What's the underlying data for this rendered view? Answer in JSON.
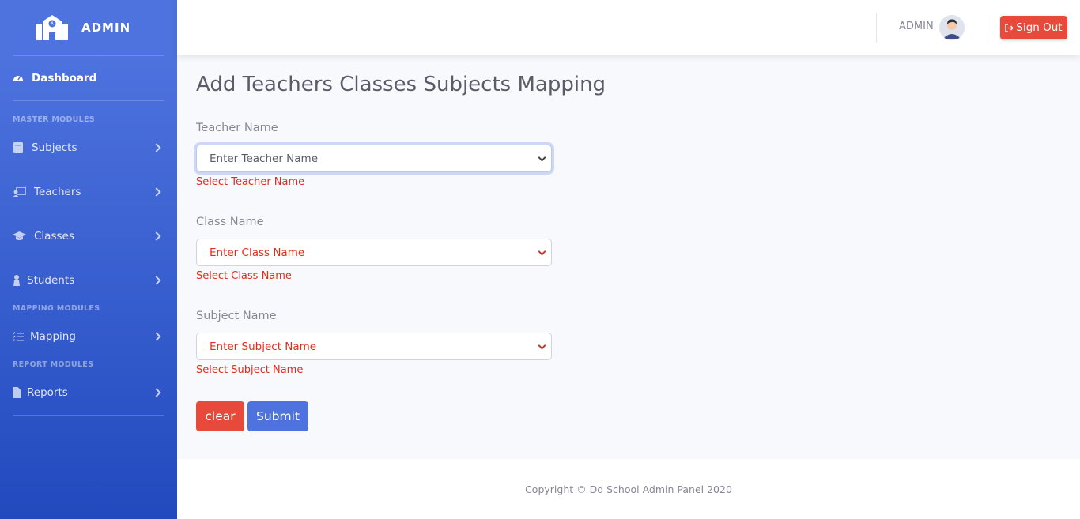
{
  "brand": {
    "name": "ADMIN",
    "icon": "school-icon"
  },
  "sidebar": {
    "dashboard": {
      "label": "Dashboard",
      "icon": "tachometer-icon"
    },
    "headings": {
      "master": "MASTER MODULES",
      "mapping": "MAPPING MODULES",
      "report": "REPORT MODULES"
    },
    "items": [
      {
        "label": "Subjects",
        "icon": "book-icon"
      },
      {
        "label": "Teachers",
        "icon": "chalkboard-teacher-icon"
      },
      {
        "label": "Classes",
        "icon": "graduation-cap-icon"
      },
      {
        "label": "Students",
        "icon": "user-tie-icon"
      },
      {
        "label": "Mapping",
        "icon": "list-check-icon"
      },
      {
        "label": "Reports",
        "icon": "file-icon"
      }
    ]
  },
  "topbar": {
    "user_name": "ADMIN",
    "signout_label": "Sign Out"
  },
  "main": {
    "title": "Add Teachers Classes Subjects Mapping",
    "teacher": {
      "label": "Teacher Name",
      "selected": "Enter Teacher Name",
      "error": "Select Teacher Name"
    },
    "class": {
      "label": "Class Name",
      "selected": "Enter Class Name",
      "error": "Select Class Name"
    },
    "subject": {
      "label": "Subject Name",
      "selected": "Enter Subject Name",
      "error": "Select Subject Name"
    },
    "clear_label": "clear",
    "submit_label": "Submit"
  },
  "footer": {
    "text": "Copyright © Dd School Admin Panel 2020"
  },
  "colors": {
    "primary": "#4e73df",
    "danger": "#e74a3b",
    "error_text": "#e02d1b"
  }
}
